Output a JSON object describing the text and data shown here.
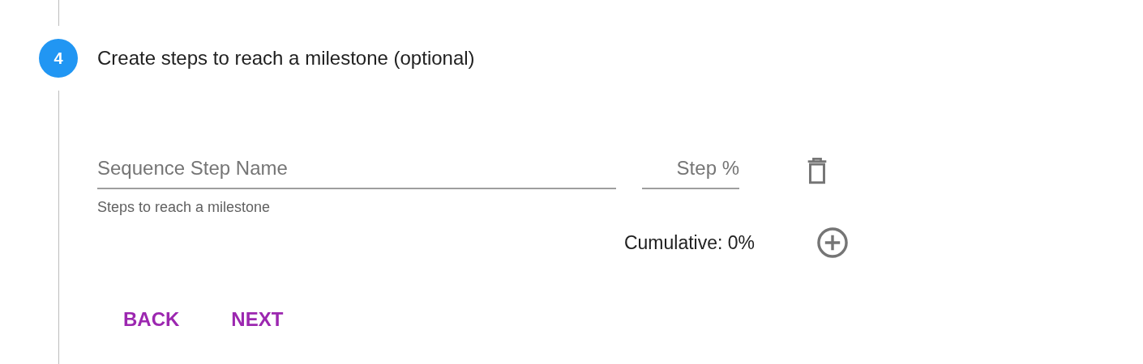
{
  "step": {
    "number": "4",
    "title": "Create steps to reach a milestone (optional)"
  },
  "sequence_steps": [
    {
      "name_field": {
        "placeholder": "Sequence Step Name"
      },
      "percent_field": {
        "placeholder": "Step %"
      },
      "helper": "Steps to reach a milestone"
    }
  ],
  "cumulative": "Cumulative: 0%",
  "buttons": [
    {
      "label": "BACK"
    },
    {
      "label": "NEXT"
    }
  ]
}
